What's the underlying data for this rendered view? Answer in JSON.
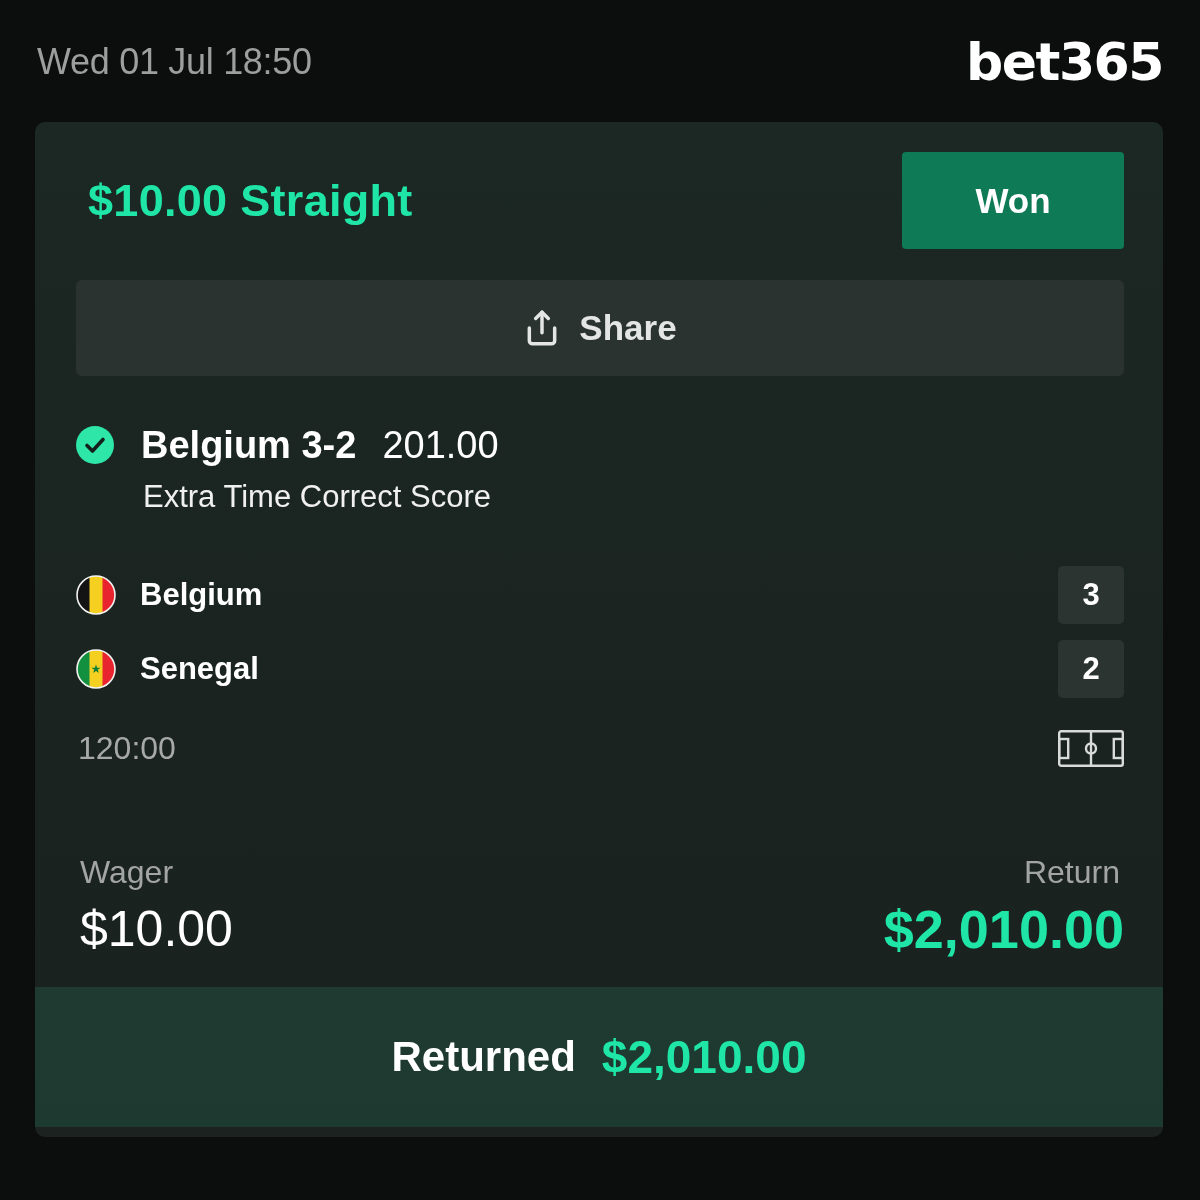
{
  "header": {
    "datetime": "Wed 01 Jul 18:50",
    "logo": "bet365"
  },
  "bet": {
    "title": "$10.00 Straight",
    "status": "Won",
    "share_button": "Share",
    "selection": {
      "won": true,
      "name": "Belgium 3-2",
      "odds": "201.00",
      "market": "Extra Time Correct Score"
    },
    "teams": [
      {
        "kind": "belgium",
        "name": "Belgium",
        "score": "3"
      },
      {
        "kind": "senegal",
        "name": "Senegal",
        "score": "2"
      }
    ],
    "clock": "120:00",
    "wager": {
      "label": "Wager",
      "value": "$10.00"
    },
    "return": {
      "label": "Return",
      "value": "$2,010.00"
    }
  },
  "returned": {
    "label": "Returned",
    "value": "$2,010.00"
  }
}
